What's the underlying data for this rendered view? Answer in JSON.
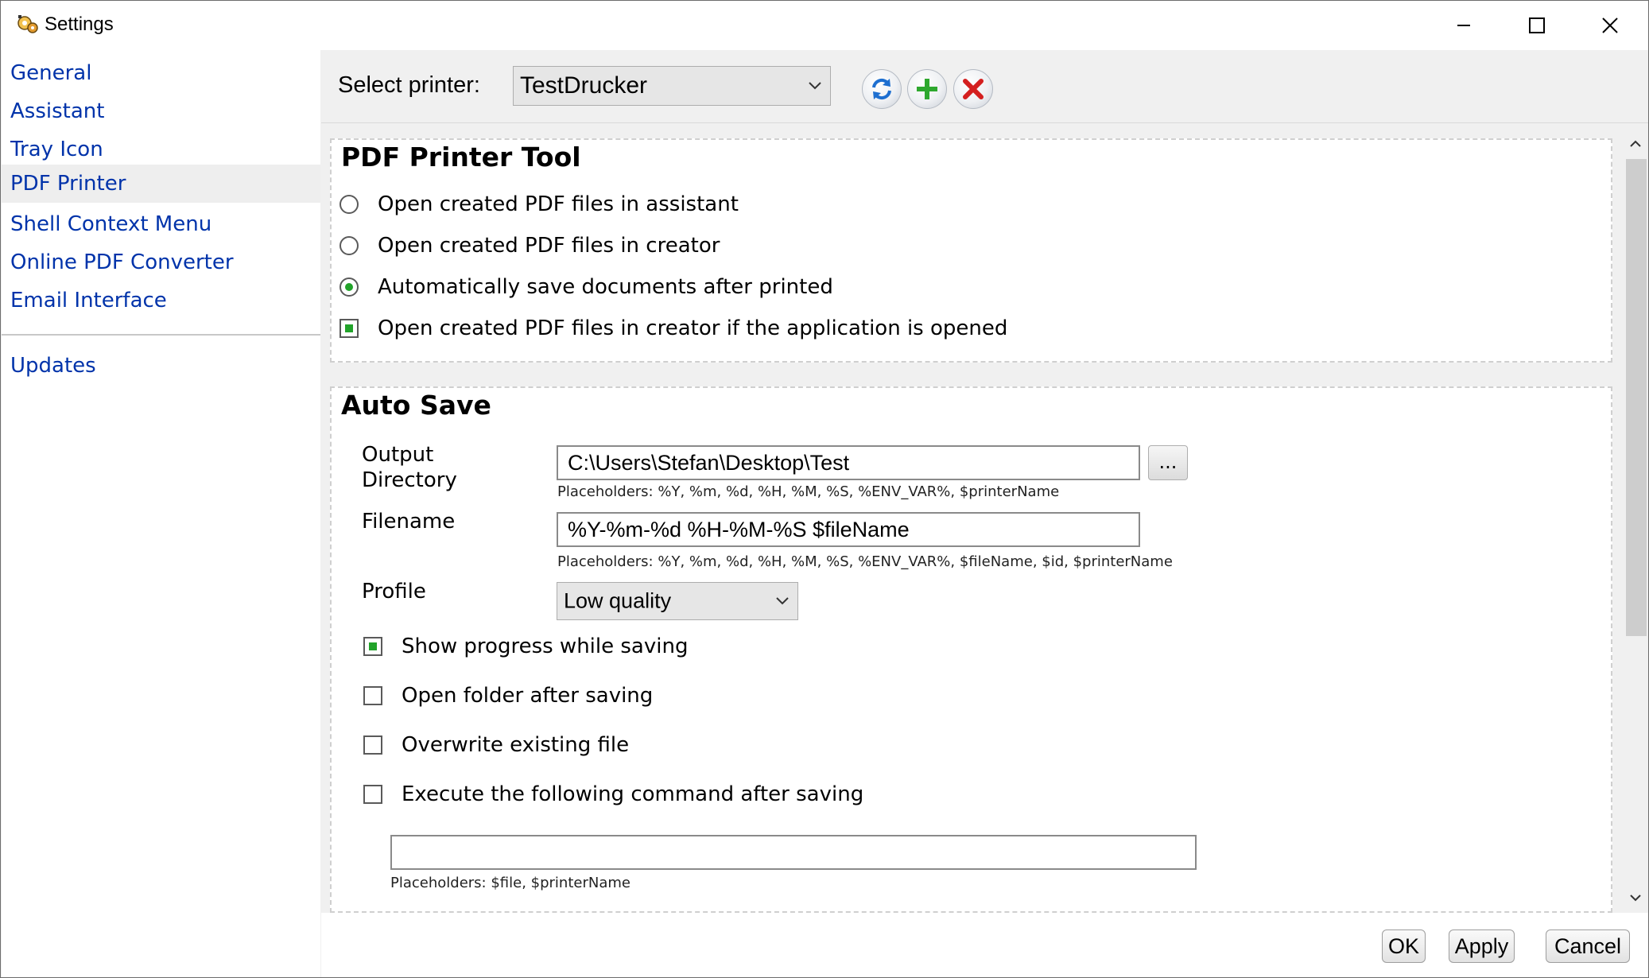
{
  "window": {
    "title": "Settings",
    "controls": [
      "minimize-icon",
      "maximize-icon",
      "close-icon"
    ]
  },
  "sidebar": {
    "items": [
      {
        "label": "General"
      },
      {
        "label": "Assistant"
      },
      {
        "label": "Tray Icon"
      },
      {
        "label": "PDF Printer",
        "active": true
      },
      {
        "label": "Shell Context Menu"
      },
      {
        "label": "Online PDF Converter"
      },
      {
        "label": "Email Interface"
      },
      {
        "label": "Updates"
      }
    ]
  },
  "printer": {
    "label": "Select printer:",
    "selected": "TestDrucker",
    "buttons": [
      "refresh-icon",
      "add-icon",
      "delete-icon"
    ]
  },
  "pdf_printer_tool": {
    "title": "PDF Printer Tool",
    "options": [
      {
        "label": "Open created PDF files in assistant",
        "type": "radio",
        "checked": false
      },
      {
        "label": "Open created PDF files in creator",
        "type": "radio",
        "checked": false
      },
      {
        "label": "Automatically save documents after printed",
        "type": "radio",
        "checked": true
      },
      {
        "label": "Open created PDF files in creator if the application is opened",
        "type": "checkbox",
        "checked": true
      }
    ]
  },
  "auto_save": {
    "title": "Auto Save",
    "output_directory": {
      "label_line1": "Output",
      "label_line2": "Directory",
      "value": "C:\\Users\\Stefan\\Desktop\\Test",
      "browse_label": "...",
      "hint": "Placeholders: %Y, %m, %d, %H, %M, %S, %ENV_VAR%, $printerName"
    },
    "filename": {
      "label": "Filename",
      "value": "%Y-%m-%d %H-%M-%S $fileName",
      "hint": "Placeholders: %Y, %m, %d, %H, %M, %S, %ENV_VAR%, $fileName, $id, $printerName"
    },
    "profile": {
      "label": "Profile",
      "selected": "Low quality"
    },
    "checkboxes": [
      {
        "label": "Show progress while saving",
        "checked": true
      },
      {
        "label": "Open folder after saving",
        "checked": false
      },
      {
        "label": "Overwrite existing file",
        "checked": false
      },
      {
        "label": "Execute the following command after saving",
        "checked": false
      }
    ],
    "command": {
      "value": "",
      "hint": "Placeholders: $file, $printerName"
    }
  },
  "footer": {
    "ok": "OK",
    "apply": "Apply",
    "cancel": "Cancel"
  },
  "colors": {
    "nav_link": "#0033aa",
    "check_fill": "#22a32a",
    "active_nav_bg": "#eeeeee"
  }
}
